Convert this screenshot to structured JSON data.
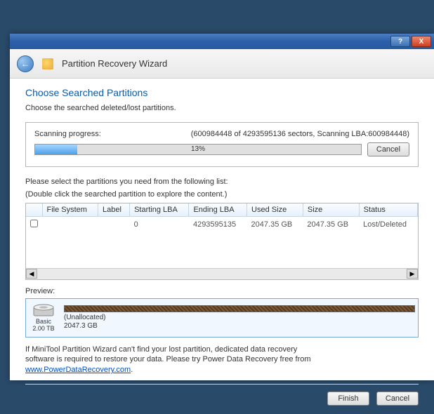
{
  "titlebar": {
    "help": "?",
    "close": "X"
  },
  "header": {
    "title": "Partition Recovery Wizard"
  },
  "page": {
    "title": "Choose Searched Partitions",
    "subtitle": "Choose the searched deleted/lost partitions."
  },
  "progress": {
    "label": "Scanning progress:",
    "status": "(600984448 of 4293595136 sectors, Scanning LBA:600984448)",
    "percent_text": "13%",
    "cancel": "Cancel"
  },
  "instructions": {
    "line1": "Please select the partitions you need from the following list:",
    "line2": "(Double click the searched partition to explore the content.)"
  },
  "table": {
    "headers": {
      "h0": "",
      "h1": "File System",
      "h2": "Label",
      "h3": "Starting LBA",
      "h4": "Ending LBA",
      "h5": "Used Size",
      "h6": "Size",
      "h7": "Status"
    },
    "row": {
      "filesystem": "",
      "label": "",
      "start_lba": "0",
      "end_lba": "4293595135",
      "used_size": "2047.35 GB",
      "size": "2047.35 GB",
      "status": "Lost/Deleted"
    }
  },
  "preview": {
    "label": "Preview:",
    "disk_type": "Basic",
    "disk_size": "2.00 TB",
    "alloc_label": "(Unallocated)",
    "alloc_size": "2047.3 GB"
  },
  "footer": {
    "text1": "If MiniTool Partition Wizard can't find your lost partition, dedicated data recovery",
    "text2": "software is required to restore your data. Please try Power Data Recovery free from",
    "link": "www.PowerDataRecovery.com",
    "finish": "Finish",
    "cancel": "Cancel"
  }
}
